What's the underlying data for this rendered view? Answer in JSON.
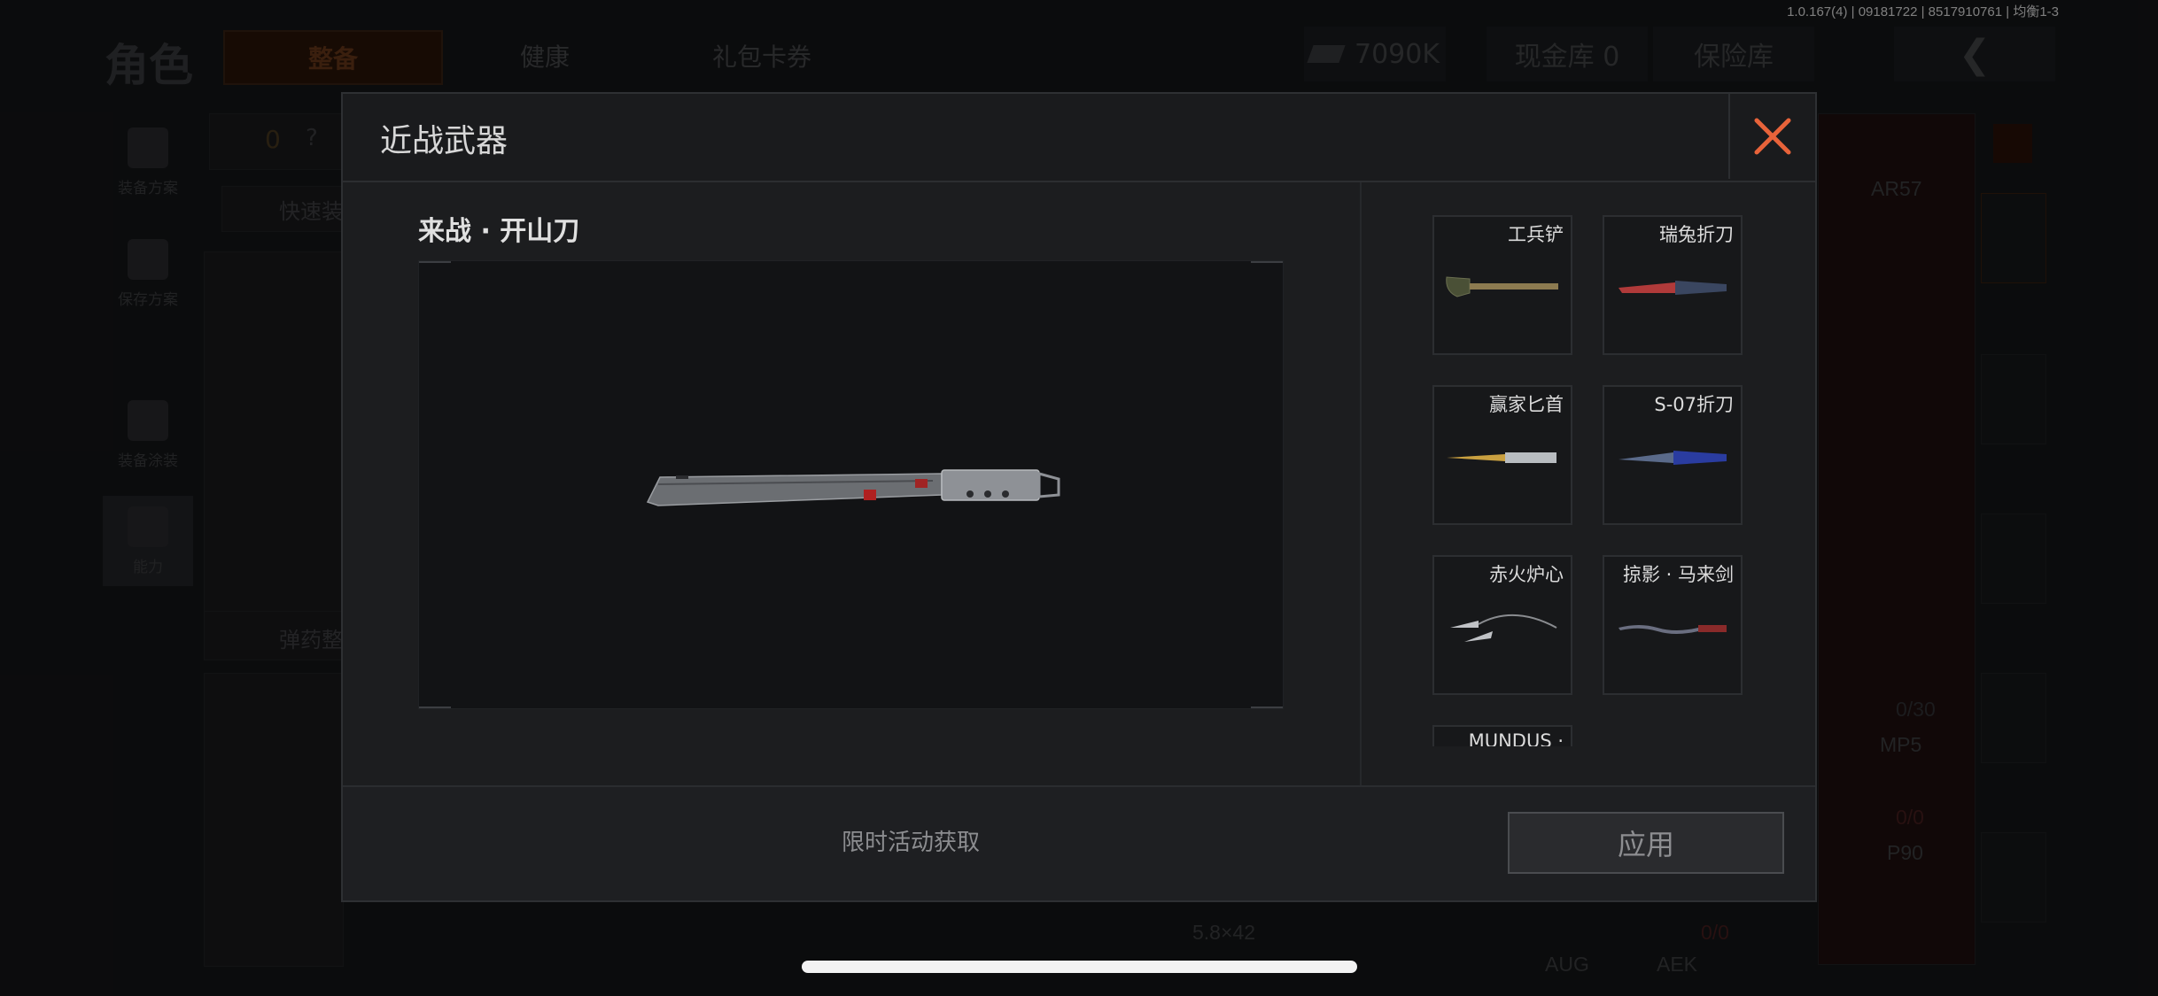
{
  "version": "1.0.167(4) | 09181722 | 8517910761 | 均衡1-3",
  "background": {
    "page_title": "角色",
    "tabs": [
      "整备",
      "健康",
      "礼包卡券"
    ],
    "currency": "7090K",
    "cash_vault": "现金库 0",
    "safe_box": "保险库",
    "sidebar": [
      "装备方案",
      "保存方案",
      "装备涂装",
      "能力"
    ],
    "quick_equip": "快速装",
    "ammo_tidy": "弹药整",
    "armor_count": "0",
    "help": "?",
    "weapons": {
      "ar57": "AR57",
      "mp5": "MP5",
      "p90": "P90",
      "aug": "AUG",
      "aek": "AEK",
      "ammo_caliber": "5.8×42",
      "ammo_count_1": "0/30",
      "ammo_count_2": "0/0",
      "ammo_count_3": "0/0"
    }
  },
  "modal": {
    "title": "近战武器",
    "selected_item_name": "来战 · 开山刀",
    "hint": "限时活动获取",
    "apply_label": "应用",
    "items": [
      {
        "name": "工兵铲",
        "icon": "shovel-icon"
      },
      {
        "name": "瑞兔折刀",
        "icon": "folding-knife-icon"
      },
      {
        "name": "赢家匕首",
        "icon": "dagger-gold-icon"
      },
      {
        "name": "S-07折刀",
        "icon": "folding-knife-blue-icon"
      },
      {
        "name": "赤火炉心",
        "icon": "kunai-pair-icon"
      },
      {
        "name": "掠影 · 马来剑",
        "icon": "kris-sword-icon"
      },
      {
        "name": "MUNDUS ·",
        "icon": "unknown-item-icon"
      }
    ]
  },
  "colors": {
    "accent_orange": "#e8633a",
    "modal_bg": "#1c1d1f"
  }
}
